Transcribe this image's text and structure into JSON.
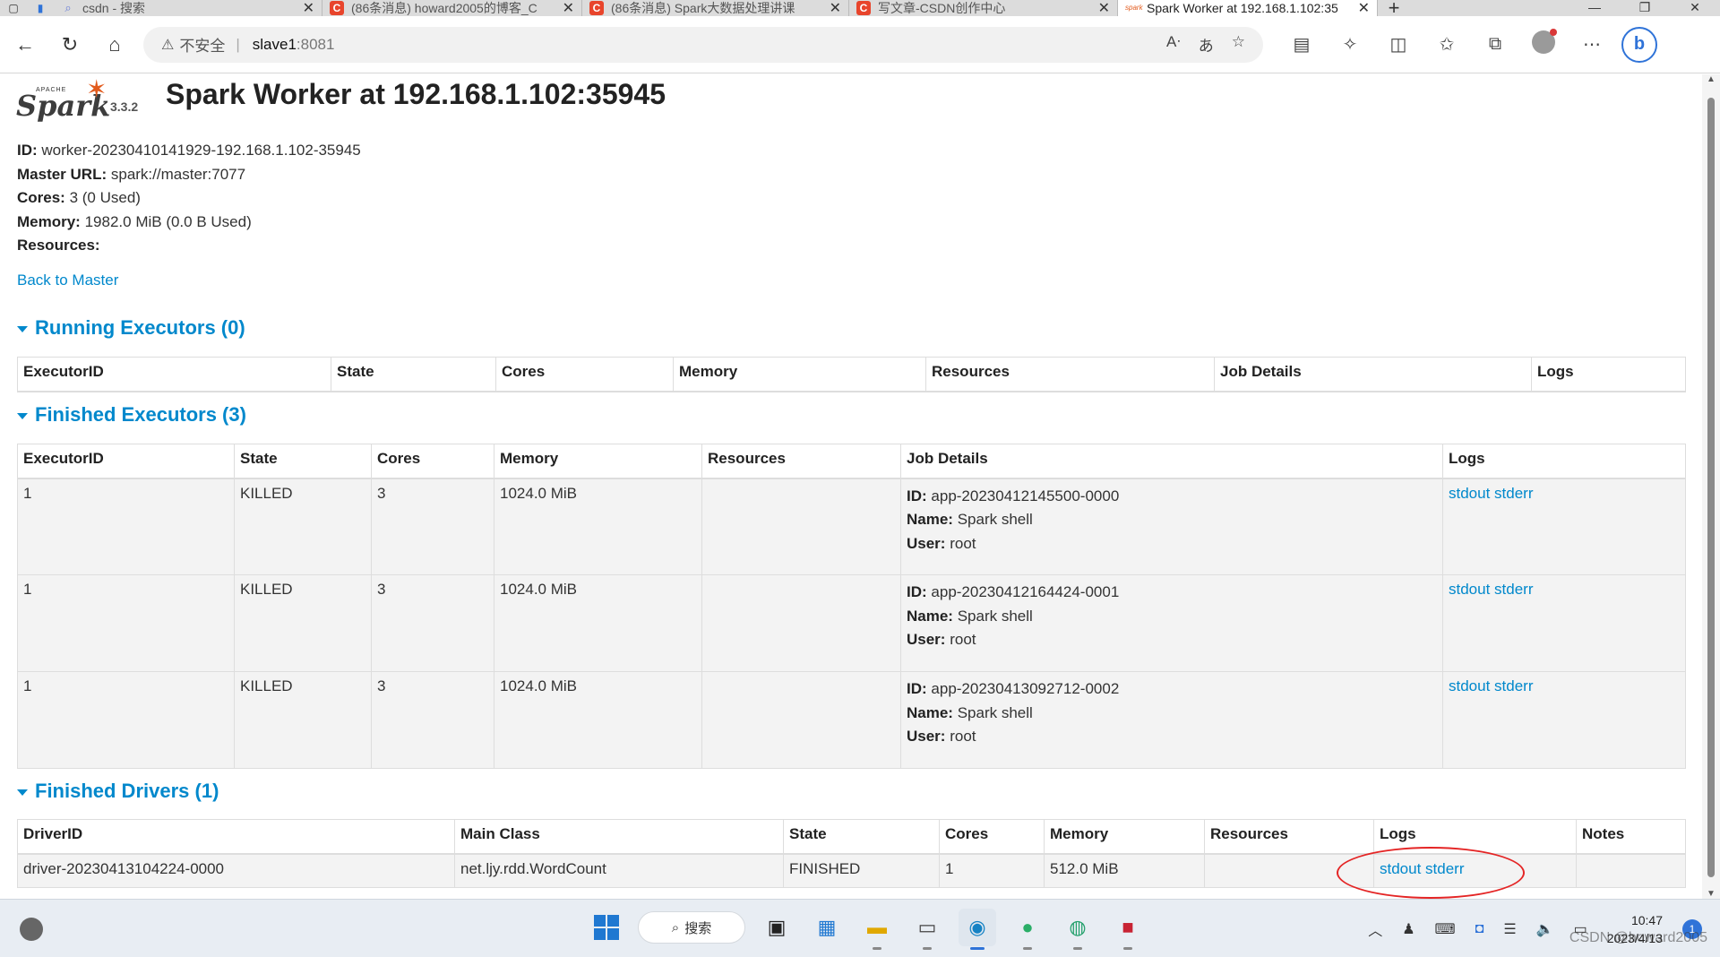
{
  "browser": {
    "tabs": [
      {
        "title": "csdn - 搜索",
        "favicon": "search-icon",
        "active": false
      },
      {
        "title": "(86条消息) howard2005的博客_C",
        "favicon": "csdn-icon",
        "active": false
      },
      {
        "title": "(86条消息) Spark大数据处理讲课",
        "favicon": "csdn-icon",
        "active": false
      },
      {
        "title": "写文章-CSDN创作中心",
        "favicon": "csdn-icon",
        "active": false
      },
      {
        "title": "Spark Worker at 192.168.1.102:35",
        "favicon": "spark-icon",
        "active": true
      }
    ],
    "address": {
      "security_label": "不安全",
      "host": "slave1",
      "port": ":8081"
    }
  },
  "page": {
    "logo_version": "3.3.2",
    "title": "Spark Worker at 192.168.1.102:35945",
    "info": {
      "id_label": "ID:",
      "id_value": "worker-20230410141929-192.168.1.102-35945",
      "master_label": "Master URL:",
      "master_value": "spark://master:7077",
      "cores_label": "Cores:",
      "cores_value": "3 (0 Used)",
      "memory_label": "Memory:",
      "memory_value": "1982.0 MiB (0.0 B Used)",
      "resources_label": "Resources:"
    },
    "back_link": "Back to Master",
    "running_executors": {
      "heading": "Running Executors (0)",
      "columns": [
        "ExecutorID",
        "State",
        "Cores",
        "Memory",
        "Resources",
        "Job Details",
        "Logs"
      ]
    },
    "finished_executors": {
      "heading": "Finished Executors (3)",
      "columns": [
        "ExecutorID",
        "State",
        "Cores",
        "Memory",
        "Resources",
        "Job Details",
        "Logs"
      ],
      "rows": [
        {
          "id": "1",
          "state": "KILLED",
          "cores": "3",
          "memory": "1024.0 MiB",
          "resources": "",
          "job_id": "app-20230412145500-0000",
          "job_name": "Spark shell",
          "job_user": "root",
          "stdout": "stdout",
          "stderr": "stderr"
        },
        {
          "id": "1",
          "state": "KILLED",
          "cores": "3",
          "memory": "1024.0 MiB",
          "resources": "",
          "job_id": "app-20230412164424-0001",
          "job_name": "Spark shell",
          "job_user": "root",
          "stdout": "stdout",
          "stderr": "stderr"
        },
        {
          "id": "1",
          "state": "KILLED",
          "cores": "3",
          "memory": "1024.0 MiB",
          "resources": "",
          "job_id": "app-20230413092712-0002",
          "job_name": "Spark shell",
          "job_user": "root",
          "stdout": "stdout",
          "stderr": "stderr"
        }
      ],
      "job_labels": {
        "id": "ID:",
        "name": "Name:",
        "user": "User:"
      }
    },
    "finished_drivers": {
      "heading": "Finished Drivers (1)",
      "columns": [
        "DriverID",
        "Main Class",
        "State",
        "Cores",
        "Memory",
        "Resources",
        "Logs",
        "Notes"
      ],
      "rows": [
        {
          "id": "driver-20230413104224-0000",
          "main_class": "net.ljy.rdd.WordCount",
          "state": "FINISHED",
          "cores": "1",
          "memory": "512.0 MiB",
          "resources": "",
          "stdout": "stdout",
          "stderr": "stderr",
          "notes": ""
        }
      ]
    },
    "annotation_color": "#e42525",
    "link_color": "#0088cc"
  },
  "taskbar": {
    "search_label": "搜索",
    "time": "10:47",
    "date": "2023/4/13",
    "notification_count": "1",
    "watermark": "CSDN @howard2005"
  }
}
